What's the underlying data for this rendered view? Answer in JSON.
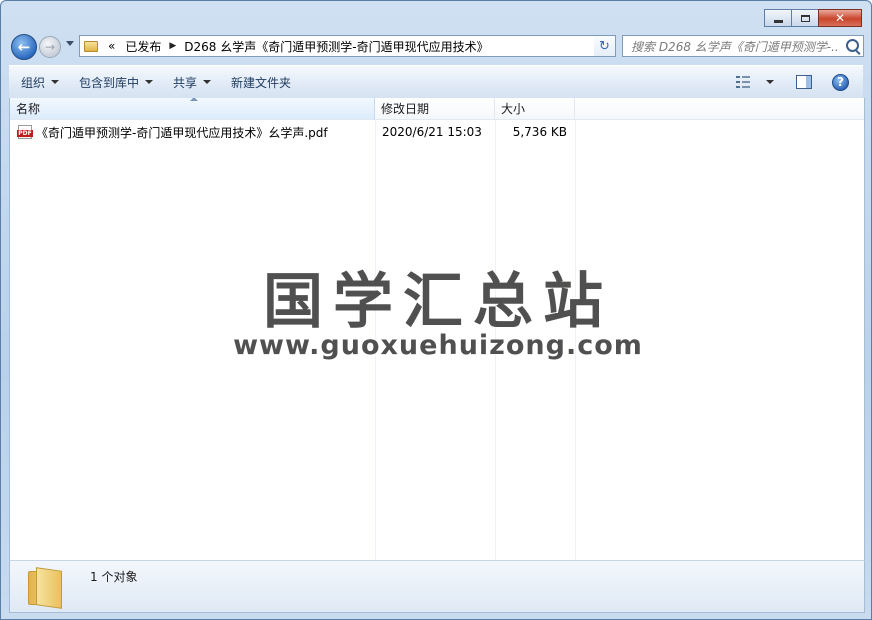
{
  "window": {
    "caption_buttons": {
      "minimize": "—",
      "maximize": "□",
      "close": "✕"
    }
  },
  "nav": {
    "back_glyph": "←",
    "forward_glyph": "→",
    "breadcrumb": {
      "overflow": "«",
      "items": [
        "已发布",
        "D268 幺学声《奇门遁甲预测学-奇门遁甲现代应用技术》"
      ]
    },
    "refresh_glyph": "↻",
    "search_placeholder": "搜索 D268 幺学声《奇门遁甲预测学-...",
    "search_icon": "search-icon"
  },
  "toolbar": {
    "organize": "组织",
    "include_in_library": "包含到库中",
    "share": "共享",
    "new_folder": "新建文件夹",
    "help": "?"
  },
  "columns": {
    "name": "名称",
    "date_modified": "修改日期",
    "size": "大小"
  },
  "files": [
    {
      "icon": "pdf-icon",
      "icon_label": "PDF",
      "name": "《奇门遁甲预测学-奇门遁甲现代应用技术》幺学声.pdf",
      "date_modified": "2020/6/21 15:03",
      "size": "5,736 KB"
    }
  ],
  "watermark": {
    "title": "国学汇总站",
    "url": "www.guoxuehuizong.com"
  },
  "status": {
    "text": "1 个对象"
  },
  "colors": {
    "frame": "#b9d1ea",
    "accent": "#2d6cc0",
    "close_button": "#c9462c",
    "pdf_badge": "#c21b1b"
  }
}
